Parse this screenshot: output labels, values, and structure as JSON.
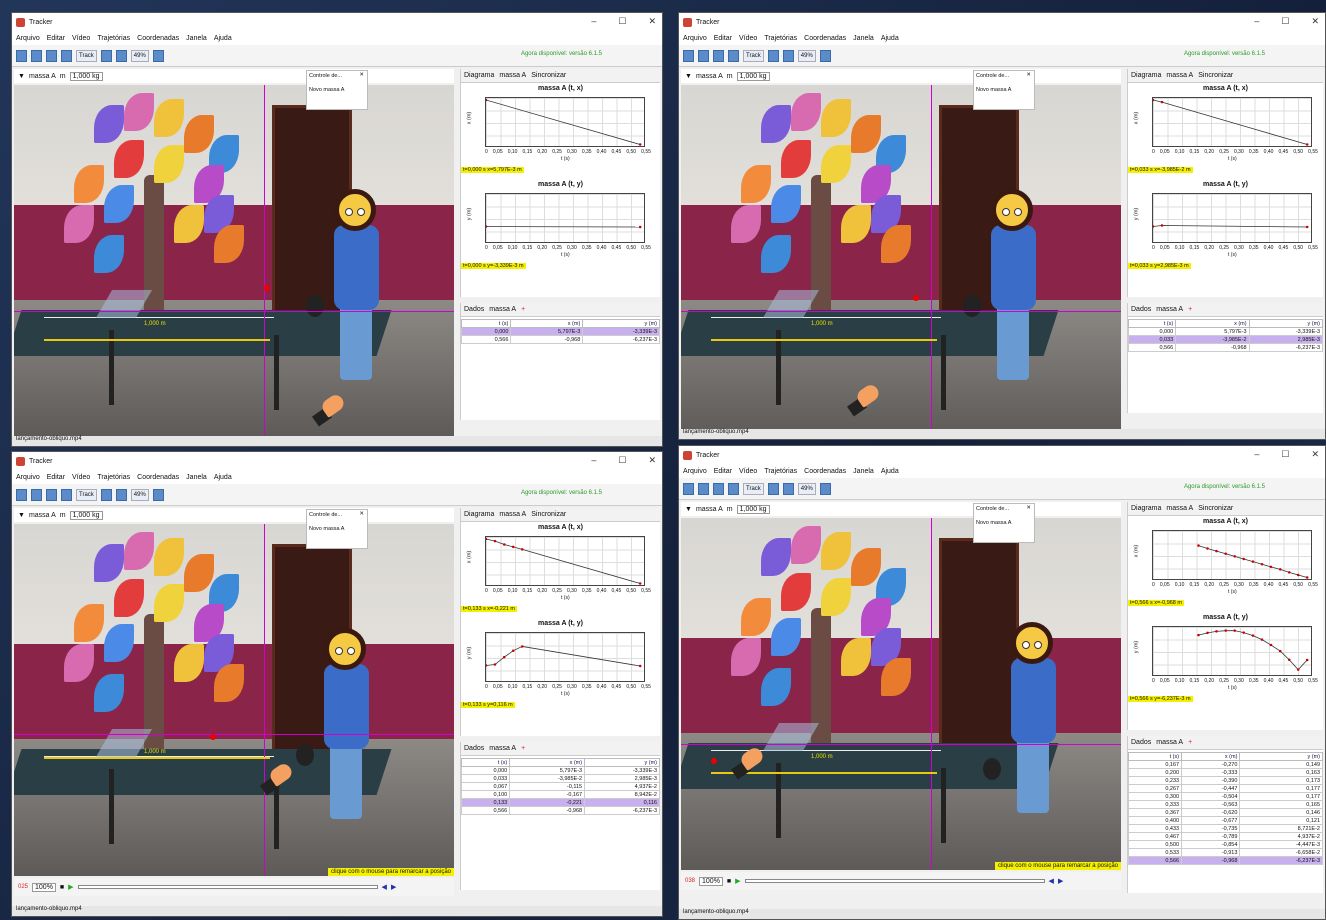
{
  "app_title": "Tracker",
  "menus": [
    "Arquivo",
    "Editar",
    "Vídeo",
    "Trajetórias",
    "Coordenadas",
    "Janela",
    "Ajuda"
  ],
  "toolbar": {
    "track": "Track",
    "zoom": "49%",
    "update_notice": "Agora disponível: versão 6.1.5"
  },
  "video_bar": {
    "mass_name": "massa A",
    "mass_field": "m",
    "mass_value": "1,000 kg"
  },
  "controls_popup": {
    "title": "Controle de...",
    "new": "Novo",
    "track": "massa A"
  },
  "ruler_label": "1,000 m",
  "click_hint": "clique com o mouse para remarcar a posição",
  "graph_panel": {
    "diagram": "Diagrama",
    "track": "massa A",
    "sync": "Sincronizar"
  },
  "data_panel": {
    "title": "Dados",
    "track": "massa A",
    "cols": [
      "t (s)",
      "x (m)",
      "y (m)"
    ]
  },
  "chart_data": [
    {
      "type": "line",
      "title": "massa A (t, x)",
      "xlabel": "t (s)",
      "ylabel": "x (m)",
      "x_ticks": [
        "0",
        "0,05",
        "0,10",
        "0,15",
        "0,20",
        "0,25",
        "0,30",
        "0,35",
        "0,40",
        "0,45",
        "0,50",
        "0,55"
      ]
    },
    {
      "type": "line",
      "title": "massa A (t, y)",
      "xlabel": "t (s)",
      "ylabel": "y (m)"
    }
  ],
  "windows": [
    {
      "readout_x": "t=0,000 s  x=5,797E-3 m",
      "readout_y": "t=0,000 s  y=-3,339E-3 m",
      "rows": [
        [
          "0,000",
          "5,797E-3",
          "-3,339E-3"
        ],
        [
          "0,566",
          "-0,968",
          "-6,237E-3"
        ]
      ],
      "sel": 0
    },
    {
      "readout_x": "t=0,033 s  x=-3,985E-2 m",
      "readout_y": "t=0,033 s  y=2,985E-3 m",
      "rows": [
        [
          "0,000",
          "5,797E-3",
          "-3,339E-3"
        ],
        [
          "0,033",
          "-3,985E-2",
          "2,985E-3"
        ],
        [
          "0,566",
          "-0,968",
          "-6,237E-3"
        ]
      ],
      "sel": 1
    },
    {
      "readout_x": "t=0,133 s  x=-0,221 m",
      "readout_y": "t=0,133 s  y=0,116 m",
      "rows": [
        [
          "0,000",
          "5,797E-3",
          "-3,339E-3"
        ],
        [
          "0,033",
          "-3,985E-2",
          "2,985E-3"
        ],
        [
          "0,067",
          "-0,115",
          "4,937E-2"
        ],
        [
          "0,100",
          "-0,167",
          "8,942E-2"
        ],
        [
          "0,133",
          "-0,221",
          "0,116"
        ],
        [
          "0,566",
          "-0,968",
          "-6,237E-3"
        ]
      ],
      "sel": 4,
      "frame": "025",
      "zoom": "100%"
    },
    {
      "readout_x": "t=0,566 s  x=-0,968 m",
      "readout_y": "t=0,566 s  y=-6,237E-3 m",
      "rows": [
        [
          "0,167",
          "-0,270",
          "0,149"
        ],
        [
          "0,200",
          "-0,333",
          "0,163"
        ],
        [
          "0,233",
          "-0,390",
          "0,173"
        ],
        [
          "0,267",
          "-0,447",
          "0,177"
        ],
        [
          "0,300",
          "-0,504",
          "0,177"
        ],
        [
          "0,333",
          "-0,563",
          "0,165"
        ],
        [
          "0,367",
          "-0,620",
          "0,146"
        ],
        [
          "0,400",
          "-0,677",
          "0,121"
        ],
        [
          "0,433",
          "-0,735",
          "8,721E-2"
        ],
        [
          "0,467",
          "-0,789",
          "4,937E-2"
        ],
        [
          "0,500",
          "-0,854",
          "-4,447E-3"
        ],
        [
          "0,533",
          "-0,913",
          "-6,658E-2"
        ],
        [
          "0,566",
          "-0,968",
          "-6,237E-3"
        ]
      ],
      "sel": 12,
      "frame": "038",
      "zoom": "100%"
    }
  ],
  "status_file": "lançamento-obliquo.mp4"
}
